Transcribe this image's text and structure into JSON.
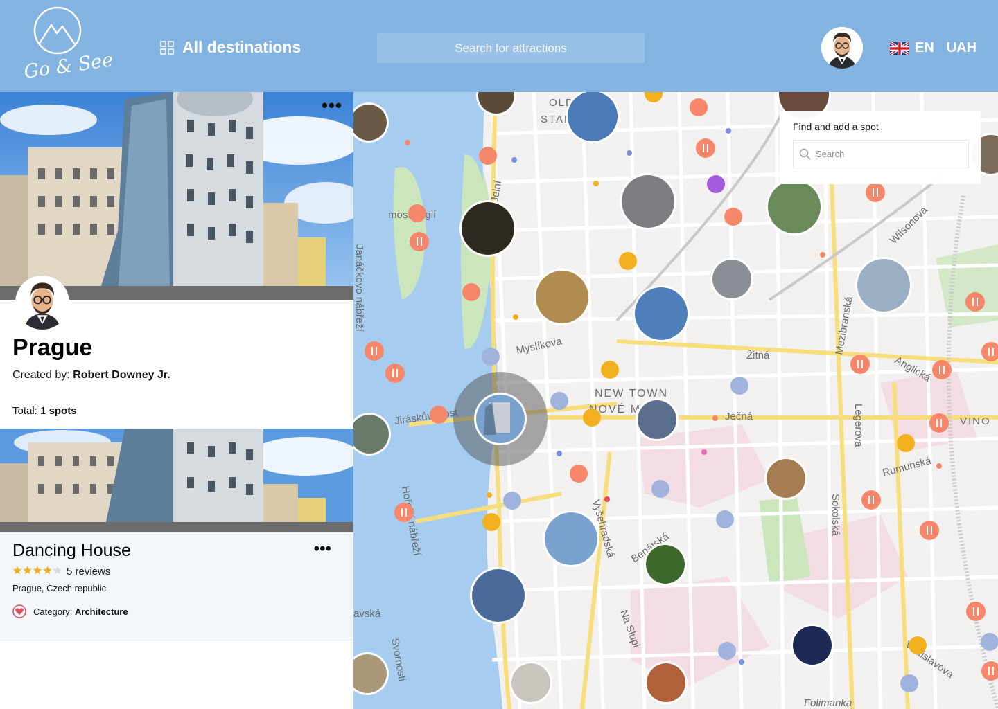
{
  "header": {
    "logo_text": "Go & See",
    "nav_label": "All destinations",
    "search_placeholder": "Search for attractions",
    "language": "EN",
    "currency": "UAH"
  },
  "destination": {
    "title": "Prague",
    "created_by_label": "Created by:",
    "author": "Robert Downey Jr.",
    "total_label": "Total:",
    "total_count": "1",
    "total_unit": "spots"
  },
  "spot": {
    "name": "Dancing House",
    "rating": 4,
    "reviews": "5 reviews",
    "location": "Prague, Czech republic",
    "category_label": "Category:",
    "category": "Architecture"
  },
  "map_panel": {
    "title": "Find and add a spot",
    "search_placeholder": "Search"
  },
  "map": {
    "labels": {
      "old_town": "OLD",
      "stare": "STAR",
      "new_town": "NEW TOWN",
      "nove_mesto": "NOVÉ M",
      "myslikova": "Myslíkova",
      "zitna": "Žitná",
      "jecna": "Ječná",
      "legerova": "Legerova",
      "sokolska": "Sokolská",
      "mezibranska": "Mezibranská",
      "wilsonova": "Wilsonova",
      "anglicka": "Anglická",
      "rumunska": "Rumunská",
      "vinohradska": "VINO",
      "janackovo": "Janáčkovo nábřeží",
      "jiraskuv": "Jiráskův most",
      "horejsi": "Hořejší nábřeží",
      "svornosti": "Svornosti",
      "na_slupi": "Na Slupi",
      "vysehradska": "Vyšehradská",
      "benatska": "Benátská",
      "vratislavova": "Vratislavova",
      "folimanka": "Folimanka",
      "jelni": "Jelní",
      "most_legii": "most Legií",
      "slavska": "avská"
    },
    "colors": {
      "restaurant": "#f6876a",
      "shop": "#f2b01e",
      "museum": "#9fb3dc",
      "water": "#a6cdf0",
      "park": "#cbe6bd",
      "road": "#fbe9a4"
    }
  }
}
